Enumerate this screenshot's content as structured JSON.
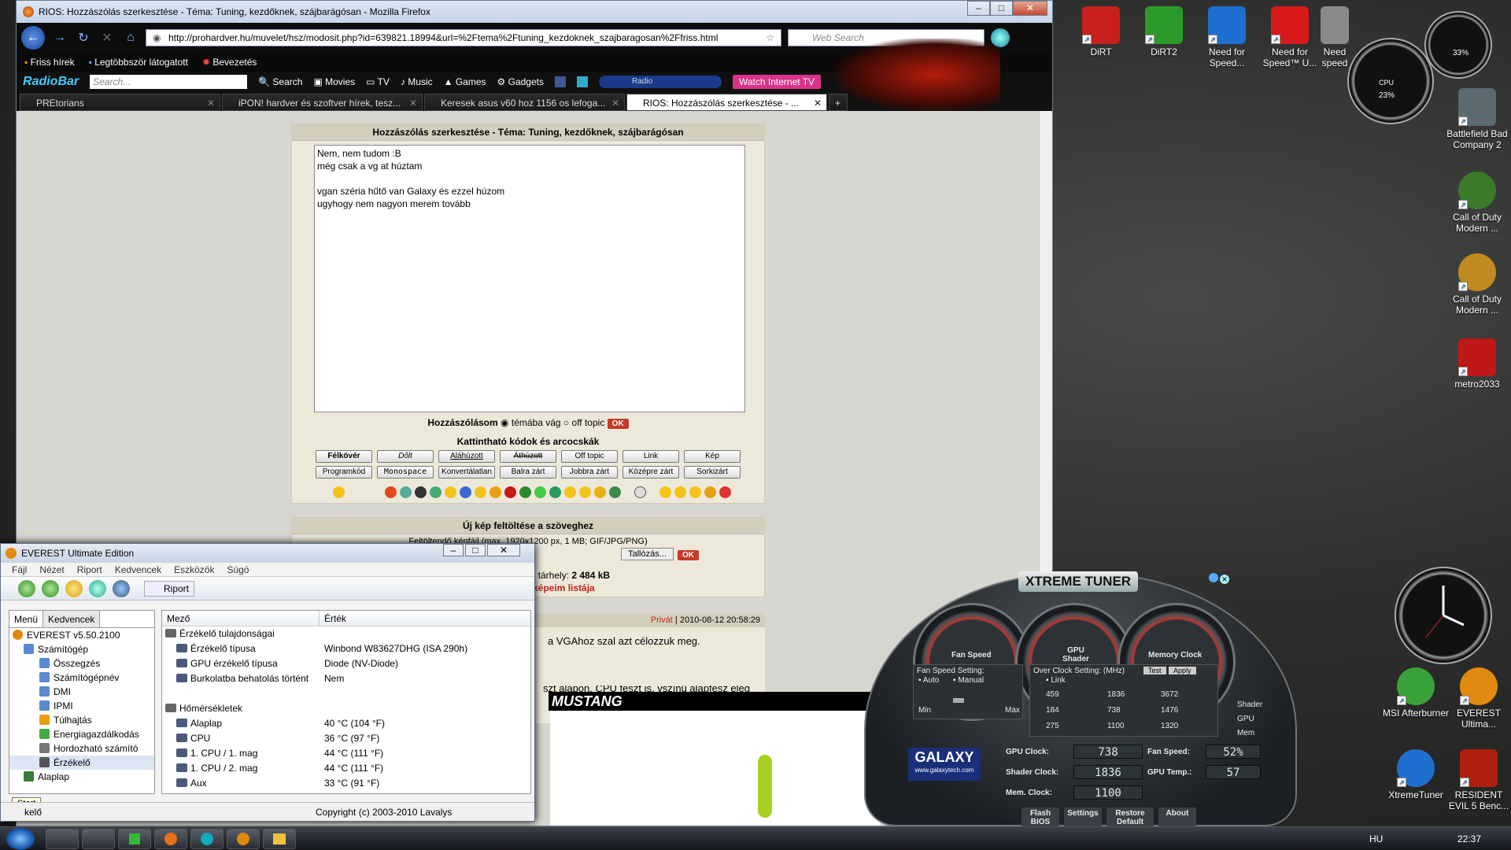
{
  "desktop": {
    "icons": [
      {
        "label": "DiRT",
        "color": "#c8201c"
      },
      {
        "label": "DiRT2",
        "color": "#2a9a2a"
      },
      {
        "label": "Need for Speed...",
        "color": "#1f6fd0"
      },
      {
        "label": "Need for Speed™ U...",
        "color": "#d81a1a"
      },
      {
        "label": "Need speed",
        "color": "#8a8a8a"
      }
    ],
    "right_icons": [
      {
        "label": "Battlefield Bad Company 2",
        "color": "#5a6a70"
      },
      {
        "label": "Call of Duty Modern ...",
        "color": "#3a7a2a"
      },
      {
        "label": "Call of Duty Modern ...",
        "color": "#c08a20"
      },
      {
        "label": "metro2033",
        "color": "#c01818"
      },
      {
        "label": "MSI Afterburner",
        "color": "#3aa23a"
      },
      {
        "label": "EVEREST Ultima...",
        "color": "#e08a10"
      },
      {
        "label": "XtremeTuner",
        "color": "#1f6fd0"
      },
      {
        "label": "RESIDENT EVIL 5 Benc...",
        "color": "#b02010"
      }
    ],
    "cpu_gadget": {
      "cpu_label": "CPU",
      "cpu_value": "23%",
      "mem_label": "MEM",
      "mem_value": "33%"
    }
  },
  "firefox": {
    "title": "RIOS: Hozzászólás szerkesztése - Téma: Tuning, kezdőknek, szájbarágósan - Mozilla Firefox",
    "url": "http://prohardver.hu/muvelet/hsz/modosit.php?id=639821.18994&url=%2Ftema%2Ftuning_kezdoknek_szajbaragosan%2Ffriss.html",
    "search_placeholder": "Web Search",
    "bookmarks": [
      "Friss hírek",
      "Legtöbbször látogatott",
      "Bevezetés"
    ],
    "radiobar": {
      "logo": "RadioBar",
      "search_placeholder": "Search...",
      "items": [
        "Search",
        "Movies",
        "TV",
        "Music",
        "Games",
        "Gadgets"
      ],
      "radio": "Radio",
      "watch": "Watch Internet TV"
    },
    "tabs": [
      {
        "label": "PREtorians"
      },
      {
        "label": "iPON! hardver és szoftver hírek, tesz..."
      },
      {
        "label": "Keresek asus v60 hoz 1156 os lefoga..."
      },
      {
        "label": "RIOS: Hozzászólás szerkesztése - ...",
        "active": true
      }
    ],
    "form": {
      "heading": "Hozzászólás szerkesztése - Téma: Tuning, kezdőknek, szájbarágósan",
      "text": "Nem, nem tudom :B\nmég csak a vg at húztam\n\nvgan széria hűtő van Galaxy és ezzel húzom\nugyhogy nem nagyon merem tovább",
      "post_label": "Hozzászólásom",
      "option1": "témába vág",
      "option2": "off topic",
      "ok": "OK",
      "codes_heading": "Kattintható kódok és arcocskák",
      "buttons_row1": [
        "Félkövér",
        "Dőlt",
        "Aláhúzott",
        "Áthúzott",
        "Off topic",
        "Link",
        "Kép"
      ],
      "buttons_row2": [
        "Programkód",
        "Monospace",
        "Konvertálatlan",
        "Balra zárt",
        "Jobbra zárt",
        "Középre zárt",
        "Sorkizárt"
      ],
      "upload_heading": "Új kép feltöltése a szöveghez",
      "upload_info": "Feltöltendő képfájl (max. 1920x1200 px, 1 MB; GIF/JPG/PNG)",
      "browse": "Tallózás...",
      "storage_label": "ló tárhely:",
      "storage_value": "2 484 kB",
      "images_link": "képeim listája"
    },
    "post": {
      "privat": "Privát",
      "datetime": "2010-08-12 20:58:29",
      "line1": "a VGAhoz szal azt célozzuk meg.",
      "line2": "szt alapon. CPU feszt is, vszínű alapfesz elég"
    },
    "banner": "MUSTANG"
  },
  "everest": {
    "title": "EVEREST Ultimate Edition",
    "menu": [
      "Fájl",
      "Nézet",
      "Riport",
      "Kedvencek",
      "Eszközök",
      "Súgó"
    ],
    "report_label": "Riport",
    "tabs": [
      "Menü",
      "Kedvencek"
    ],
    "tree": [
      "EVEREST v5.50.2100",
      "Számítógép",
      "Összegzés",
      "Számítógépnév",
      "DMI",
      "IPMI",
      "Túlhajtás",
      "Energiagazdálkodás",
      "Hordozható számító",
      "Érzékelő",
      "Alaplap"
    ],
    "col_field": "Mező",
    "col_value": "Érték",
    "rows": [
      {
        "f": "Érzékelő tulajdonságai",
        "v": "",
        "group": true
      },
      {
        "f": "Érzékelő típusa",
        "v": "Winbond W83627DHG  (ISA 290h)"
      },
      {
        "f": "GPU érzékelő típusa",
        "v": "Diode  (NV-Diode)"
      },
      {
        "f": "Burkolatba behatolás történt",
        "v": "Nem"
      },
      {
        "f": "",
        "v": ""
      },
      {
        "f": "Hőmérsékletek",
        "v": "",
        "group": true
      },
      {
        "f": "Alaplap",
        "v": "40 °C  (104 °F)"
      },
      {
        "f": "CPU",
        "v": "36 °C  (97 °F)"
      },
      {
        "f": "1. CPU / 1. mag",
        "v": "44 °C  (111 °F)"
      },
      {
        "f": "1. CPU / 2. mag",
        "v": "44 °C  (111 °F)"
      },
      {
        "f": "Aux",
        "v": "33 °C  (91 °F)"
      }
    ],
    "copyright": "Copyright (c) 2003-2010 Lavalys",
    "start_tooltip": "Start",
    "status_left": "kelő"
  },
  "xtreme": {
    "title": "XTREME TUNER",
    "fan_speed": "Fan Speed",
    "gpu_shader": "GPU Shader",
    "memory_clock": "Memory Clock",
    "fan_setting": "Fan Speed Setting:",
    "auto": "Auto",
    "manual": "Manual",
    "min": "Min",
    "max": "Max",
    "oc_setting": "Over Clock Setting: (MHz)",
    "test": "Test",
    "apply": "Apply",
    "link": "Link",
    "shader": "Shader",
    "gpu": "GPU",
    "mem": "Mem",
    "vals_row1": [
      "459",
      "1836",
      "3672"
    ],
    "vals_row2": [
      "184",
      "738",
      "1476"
    ],
    "vals_row3": [
      "275",
      "1100",
      "1320"
    ],
    "brand": "GALAXY",
    "brand_url": "www.galaxytech.com",
    "gpu_clock_label": "GPU Clock:",
    "gpu_clock": "738",
    "shader_clock_label": "Shader Clock:",
    "shader_clock": "1836",
    "mem_clock_label": "Mem. Clock:",
    "mem_clock": "1100",
    "fan_speed_label": "Fan Speed:",
    "fan_speed_val": "52%",
    "gpu_temp_label": "GPU Temp.:",
    "gpu_temp": "57",
    "buttons": [
      "Flash BIOS",
      "Settings",
      "Restore Default",
      "About"
    ]
  },
  "taskbar": {
    "lang": "HU",
    "time": "22:37"
  }
}
